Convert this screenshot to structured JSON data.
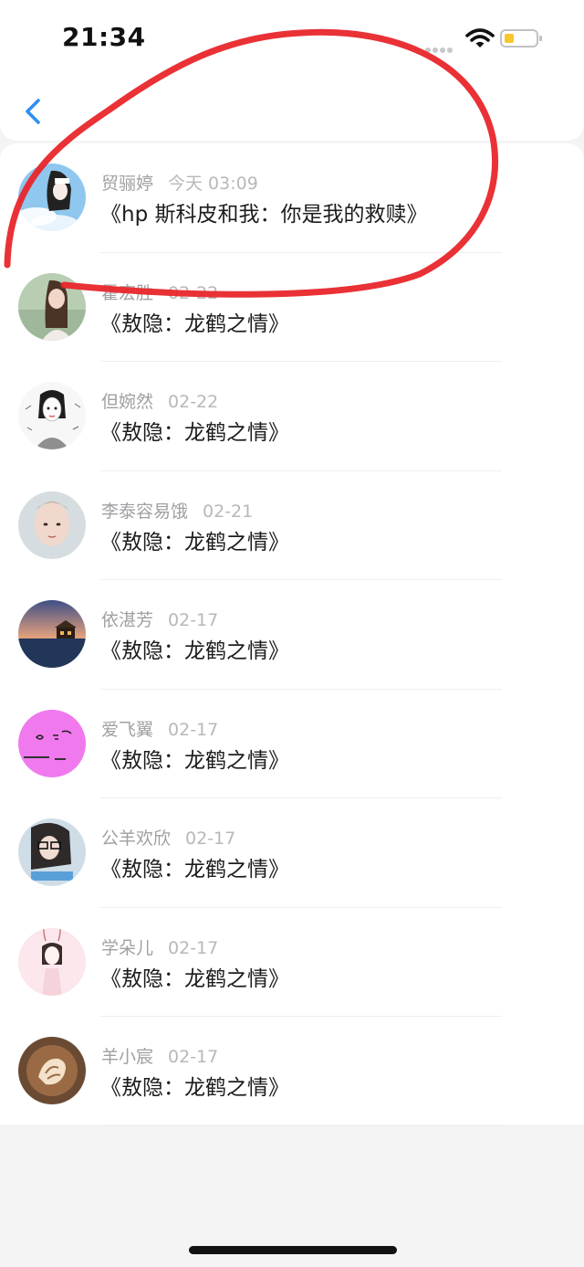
{
  "status_bar": {
    "time": "21:34"
  },
  "nav": {
    "back_icon": "chevron-left-icon",
    "accent": "#2f8ef2"
  },
  "items": [
    {
      "name": "贸骊婷",
      "date": "今天 03:09",
      "title": "《hp 斯科皮和我：你是我的救赎》",
      "avatar": "anime-girl-avatar"
    },
    {
      "name": "霍宏胜",
      "date": "02-22",
      "title": "《敖隐：龙鹤之情》",
      "avatar": "girl-photo-avatar"
    },
    {
      "name": "但婉然",
      "date": "02-22",
      "title": "《敖隐：龙鹤之情》",
      "avatar": "sketch-girl-avatar"
    },
    {
      "name": "李泰容易饿",
      "date": "02-21",
      "title": "《敖隐：龙鹤之情》",
      "avatar": "boy-face-avatar"
    },
    {
      "name": "依湛芳",
      "date": "02-17",
      "title": "《敖隐：龙鹤之情》",
      "avatar": "lake-sunset-avatar"
    },
    {
      "name": "爱飞翼",
      "date": "02-17",
      "title": "《敖隐：龙鹤之情》",
      "avatar": "pink-face-avatar"
    },
    {
      "name": "公羊欢欣",
      "date": "02-17",
      "title": "《敖隐：龙鹤之情》",
      "avatar": "glasses-girl-avatar"
    },
    {
      "name": "学朵儿",
      "date": "02-17",
      "title": "《敖隐：龙鹤之情》",
      "avatar": "bunny-girl-avatar"
    },
    {
      "name": "羊小宸",
      "date": "02-17",
      "title": "《敖隐：龙鹤之情》",
      "avatar": "latte-art-avatar"
    }
  ],
  "annotation": {
    "color": "#e8262b",
    "shape": "hand-drawn-circle"
  }
}
